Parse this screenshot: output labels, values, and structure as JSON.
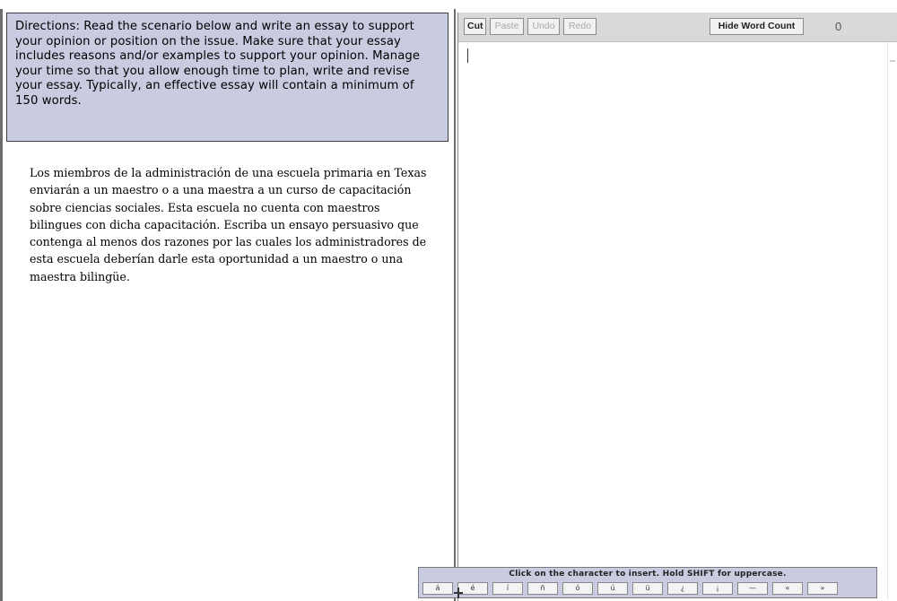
{
  "directions": "Directions: Read the scenario below and write an essay to support your opinion or position on the issue. Make sure that your essay includes reasons and/or examples to support your opinion. Manage your time so that you allow enough time to plan, write and revise your essay. Typically, an effective essay will contain a minimum of 150 words.",
  "scenario": "Los miembros de la administración de una escuela primaria en Texas enviarán a un maestro o a una maestra a un curso de capacitación sobre ciencias sociales. Esta escuela no cuenta con maestros bilingues con dicha capacitación. Escriba un ensayo persuasivo que contenga al menos dos razones por las cuales los administradores de esta escuela deberían darle esta oportunidad a un maestro o una maestra bilingüe.",
  "toolbar": {
    "cut": "Cut",
    "paste": "Paste",
    "undo": "Undo",
    "redo": "Redo",
    "hide_word_count": "Hide Word Count",
    "word_count": "0"
  },
  "editor": {
    "value": ""
  },
  "special_chars": {
    "instruction": "Click on the character to insert.  Hold SHIFT for uppercase.",
    "chars": [
      "á",
      "é",
      "í",
      "ñ",
      "ó",
      "ú",
      "ü",
      "¿",
      "¡",
      "—",
      "«",
      "»"
    ]
  }
}
